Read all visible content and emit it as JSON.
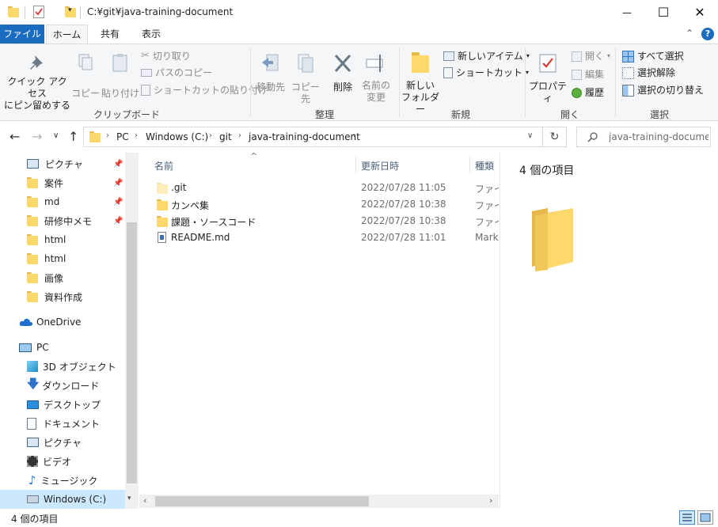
{
  "window": {
    "path_title": "C:¥git¥java-training-document",
    "minimize": "—",
    "maximize": "☐",
    "close": "✕"
  },
  "ribbon_tabs": {
    "file": "ファイル",
    "home": "ホーム",
    "share": "共有",
    "view": "表示",
    "collapse": "⌃",
    "help": "?"
  },
  "clipboard": {
    "pin_quick_access": [
      "クイック アクセス",
      "にピン留めする"
    ],
    "copy": "コピー",
    "paste": "貼り付け",
    "cut": "切り取り",
    "copy_path": "パスのコピー",
    "paste_shortcut": "ショートカットの貼り付け",
    "group_label": "クリップボード"
  },
  "organize": {
    "move_to": "移動先",
    "copy_to": "コピー先",
    "delete": "削除",
    "rename": [
      "名前の",
      "変更"
    ],
    "group_label": "整理"
  },
  "new_group": {
    "new_folder": [
      "新しい",
      "フォルダー"
    ],
    "new_item": "新しいアイテム",
    "easy_access": "ショートカット",
    "group_label": "新規"
  },
  "open_group": {
    "properties": "プロパティ",
    "open": "開く",
    "edit": "編集",
    "history": "履歴",
    "group_label": "開く"
  },
  "select_group": {
    "select_all": "すべて選択",
    "select_none": "選択解除",
    "invert_selection": "選択の切り替え",
    "group_label": "選択"
  },
  "address": {
    "back": "←",
    "forward": "→",
    "recent": "∨",
    "up": "↑",
    "segments": [
      "PC",
      "Windows (C:)",
      "git",
      "java-training-document"
    ],
    "dropdown": "∨",
    "refresh": "↻",
    "search_placeholder": "java-training-docume..."
  },
  "nav_pane": {
    "quick_access": [
      {
        "label": "ピクチャ",
        "pinned": true
      },
      {
        "label": "案件",
        "pinned": true
      },
      {
        "label": "md",
        "pinned": true
      },
      {
        "label": "研修中メモ",
        "pinned": true
      },
      {
        "label": "html",
        "pinned": false
      },
      {
        "label": "html",
        "pinned": false
      },
      {
        "label": "画像",
        "pinned": false
      },
      {
        "label": "資料作成",
        "pinned": false
      }
    ],
    "onedrive": "OneDrive",
    "pc": "PC",
    "pc_items": [
      "3D オブジェクト",
      "ダウンロード",
      "デスクトップ",
      "ドキュメント",
      "ピクチャ",
      "ビデオ",
      "ミュージック"
    ],
    "selected_drive": "Windows (C:)"
  },
  "file_list": {
    "headers": {
      "name": "名前",
      "date": "更新日時",
      "type": "種類"
    },
    "sort_indicator": "^",
    "rows": [
      {
        "name": ".git",
        "date": "2022/07/28 11:05",
        "type": "ファイル",
        "icon": "folder-hidden"
      },
      {
        "name": "カンペ集",
        "date": "2022/07/28 10:38",
        "type": "ファイル",
        "icon": "folder"
      },
      {
        "name": "課題・ソースコード",
        "date": "2022/07/28 10:38",
        "type": "ファイル",
        "icon": "folder"
      },
      {
        "name": "README.md",
        "date": "2022/07/28 11:01",
        "type": "Markdown",
        "icon": "markdown-file"
      }
    ]
  },
  "preview": {
    "item_count": "4 個の項目"
  },
  "status": {
    "item_count": "4 個の項目"
  },
  "colors": {
    "accent": "#1a6cbf",
    "selected_bg": "#cce8ff",
    "folder": "#ffd86b"
  }
}
